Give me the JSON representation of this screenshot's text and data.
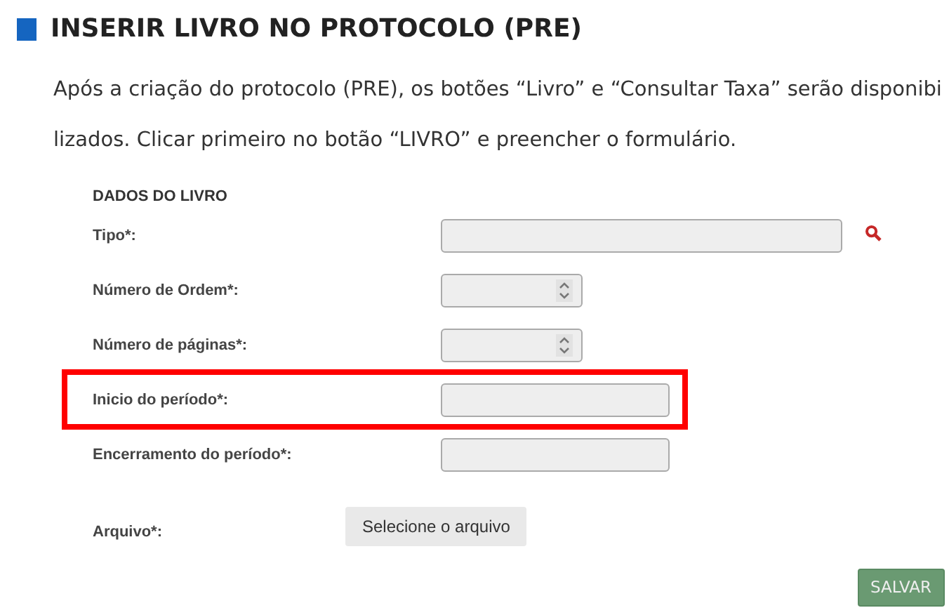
{
  "heading": "INSERIR LIVRO NO PROTOCOLO (PRE)",
  "intro_lines": [
    "Após a criação do protocolo (PRE), os botões “Livro” e “Consultar Taxa” serão disponibi",
    "lizados. Clicar primeiro no botão “LIVRO” e preencher o formulário."
  ],
  "form": {
    "section_title": "DADOS DO LIVRO",
    "fields": [
      {
        "label": "Tipo*:",
        "kind": "lookup",
        "highlighted": false
      },
      {
        "label": "Número de Ordem*:",
        "kind": "number",
        "highlighted": false
      },
      {
        "label": "Número de páginas*:",
        "kind": "number",
        "highlighted": false
      },
      {
        "label": "Inicio do período*:",
        "kind": "date",
        "highlighted": true
      },
      {
        "label": "Encerramento do período*:",
        "kind": "date",
        "highlighted": false
      },
      {
        "label": "Arquivo*:",
        "kind": "file",
        "button": "Selecione o arquivo",
        "highlighted": false
      }
    ],
    "submit": "SALVAR"
  }
}
